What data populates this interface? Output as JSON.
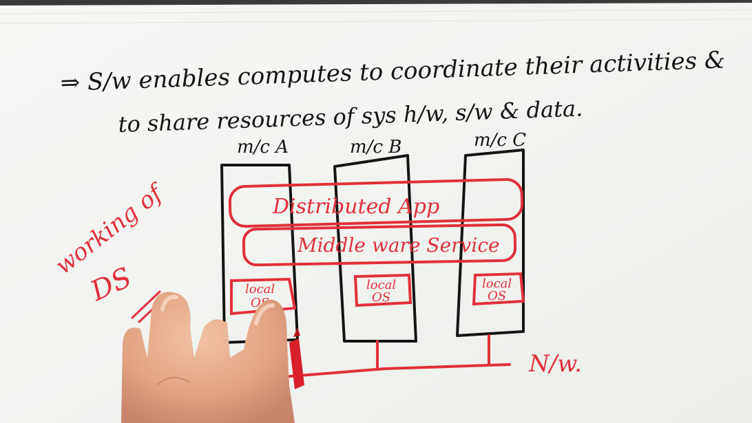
{
  "notes": {
    "line1": "⇒ S/w enables computes to coordinate their activities &",
    "line2": "to share resources of sys h/w, s/w & data."
  },
  "side_label": {
    "line1": "working of",
    "line2": "DS"
  },
  "machines": [
    {
      "label": "m/c A",
      "os_line1": "local",
      "os_line2": "OS"
    },
    {
      "label": "m/c B",
      "os_line1": "local",
      "os_line2": "OS"
    },
    {
      "label": "m/c C",
      "os_line1": "local",
      "os_line2": "OS"
    }
  ],
  "layers": {
    "app": "Distributed App",
    "middleware": "Middle ware Service"
  },
  "network": "N/w.",
  "colors": {
    "ink_black": "#141414",
    "ink_red": "#e0303a",
    "paper": "#f4f5f1"
  }
}
